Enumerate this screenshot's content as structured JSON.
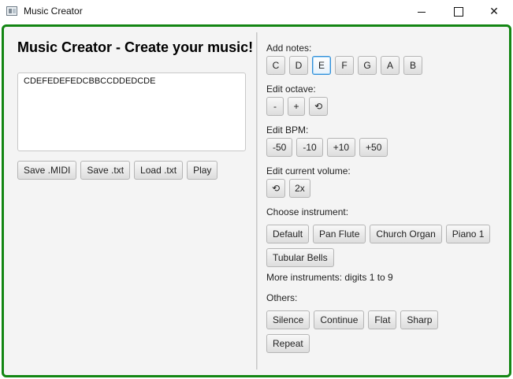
{
  "window": {
    "title": "Music Creator",
    "minimize_glyph": "",
    "maximize_glyph": "",
    "close_glyph": "✕"
  },
  "left": {
    "heading": "Music Creator - Create your music!",
    "notes_text": "CDEFEDEFEDCBBCCDDEDCDE",
    "buttons": [
      "Save .MIDI",
      "Save .txt",
      "Load .txt",
      "Play"
    ]
  },
  "right": {
    "add_notes": {
      "label": "Add notes:",
      "notes": [
        "C",
        "D",
        "E",
        "F",
        "G",
        "A",
        "B"
      ],
      "focused_note": "E"
    },
    "edit_octave": {
      "label": "Edit octave:",
      "buttons": [
        "-",
        "+",
        "⟲"
      ]
    },
    "edit_bpm": {
      "label": "Edit BPM:",
      "buttons": [
        "-50",
        "-10",
        "+10",
        "+50"
      ]
    },
    "edit_volume": {
      "label": "Edit current volume:",
      "buttons": [
        "⟲",
        "2x"
      ]
    },
    "choose_instrument": {
      "label": "Choose instrument:",
      "buttons": [
        "Default",
        "Pan Flute",
        "Church Organ",
        "Piano 1",
        "Tubular Bells"
      ]
    },
    "more_instruments": "More instruments: digits 1 to 9",
    "others": {
      "label": "Others:",
      "buttons": [
        "Silence",
        "Continue",
        "Flat",
        "Sharp",
        "Repeat"
      ]
    }
  },
  "colors": {
    "frame_border": "#138613",
    "panel_bg": "#f4f4f4",
    "focus_blue": "#2f8fd8"
  }
}
